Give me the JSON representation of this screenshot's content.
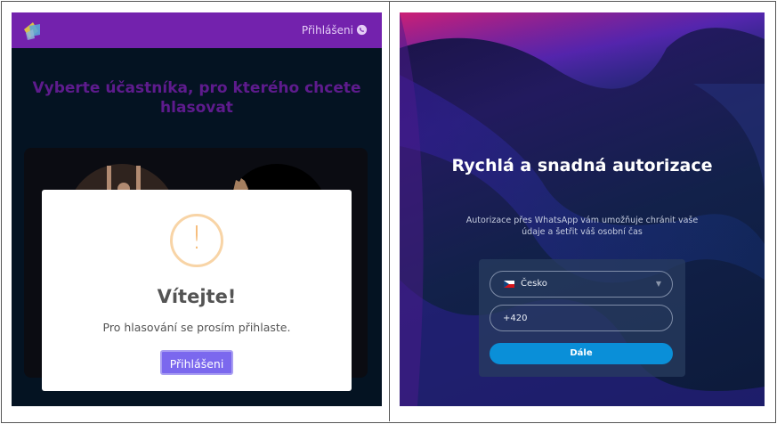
{
  "left_panel": {
    "header": {
      "login_link": "Přihlášeni"
    },
    "page_title": "Vyberte účastníka, pro kterého chcete hlasovat",
    "modal": {
      "warning_symbol": "!",
      "title": "Vítejte!",
      "text": "Pro hlasování se prosím přihlaste.",
      "button": "Přihlášeni"
    }
  },
  "right_panel": {
    "title": "Rychlá a snadná autorizace",
    "subtitle": "Autorizace přes WhatsApp vám umožňuje chránit vaše údaje a šetřit váš osobní čas",
    "form": {
      "country_select": "Česko",
      "phone_value": "+420",
      "next_button": "Dále"
    }
  },
  "colors": {
    "header_purple": "#7322ad",
    "modal_button": "#7b68ee",
    "next_button": "#0a8fd8",
    "warning": "#f5b56b"
  },
  "icons": [
    "logo-icon",
    "whatsapp-icon",
    "warning-icon",
    "czech-flag-icon",
    "chevron-down-icon"
  ]
}
